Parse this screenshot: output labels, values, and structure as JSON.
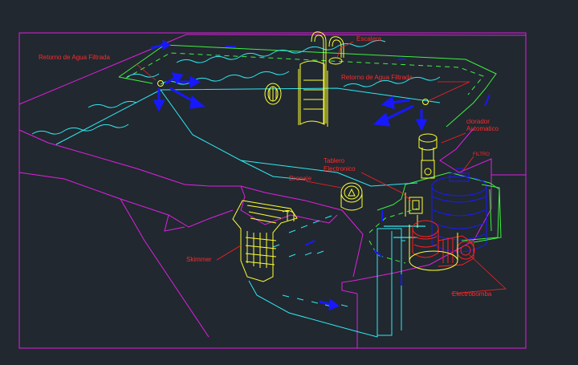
{
  "labels": {
    "escalera": "Escalera",
    "retorno_left": "Retorno de Agua Filtrada",
    "retorno_right": "Retorno de Agua Filtrada",
    "clorador": "clorador",
    "clorador_2": "Automatico",
    "filtro": "FILTRO",
    "tablero": "Tablero",
    "tablero_2": "Electronico",
    "drenaje": "Drenaje",
    "skimmer": "Skimmer",
    "electrobomba": "Electrobomba"
  },
  "colors": {
    "background": "#212830",
    "frame": "#e020e0",
    "water": "#30e8f0",
    "coping": "#40f040",
    "fixtures": "#ffff30",
    "flow": "#1818ff",
    "label": "#ff2a2a",
    "filter_tank": "#1a1aff",
    "pump": "#ff2020"
  }
}
